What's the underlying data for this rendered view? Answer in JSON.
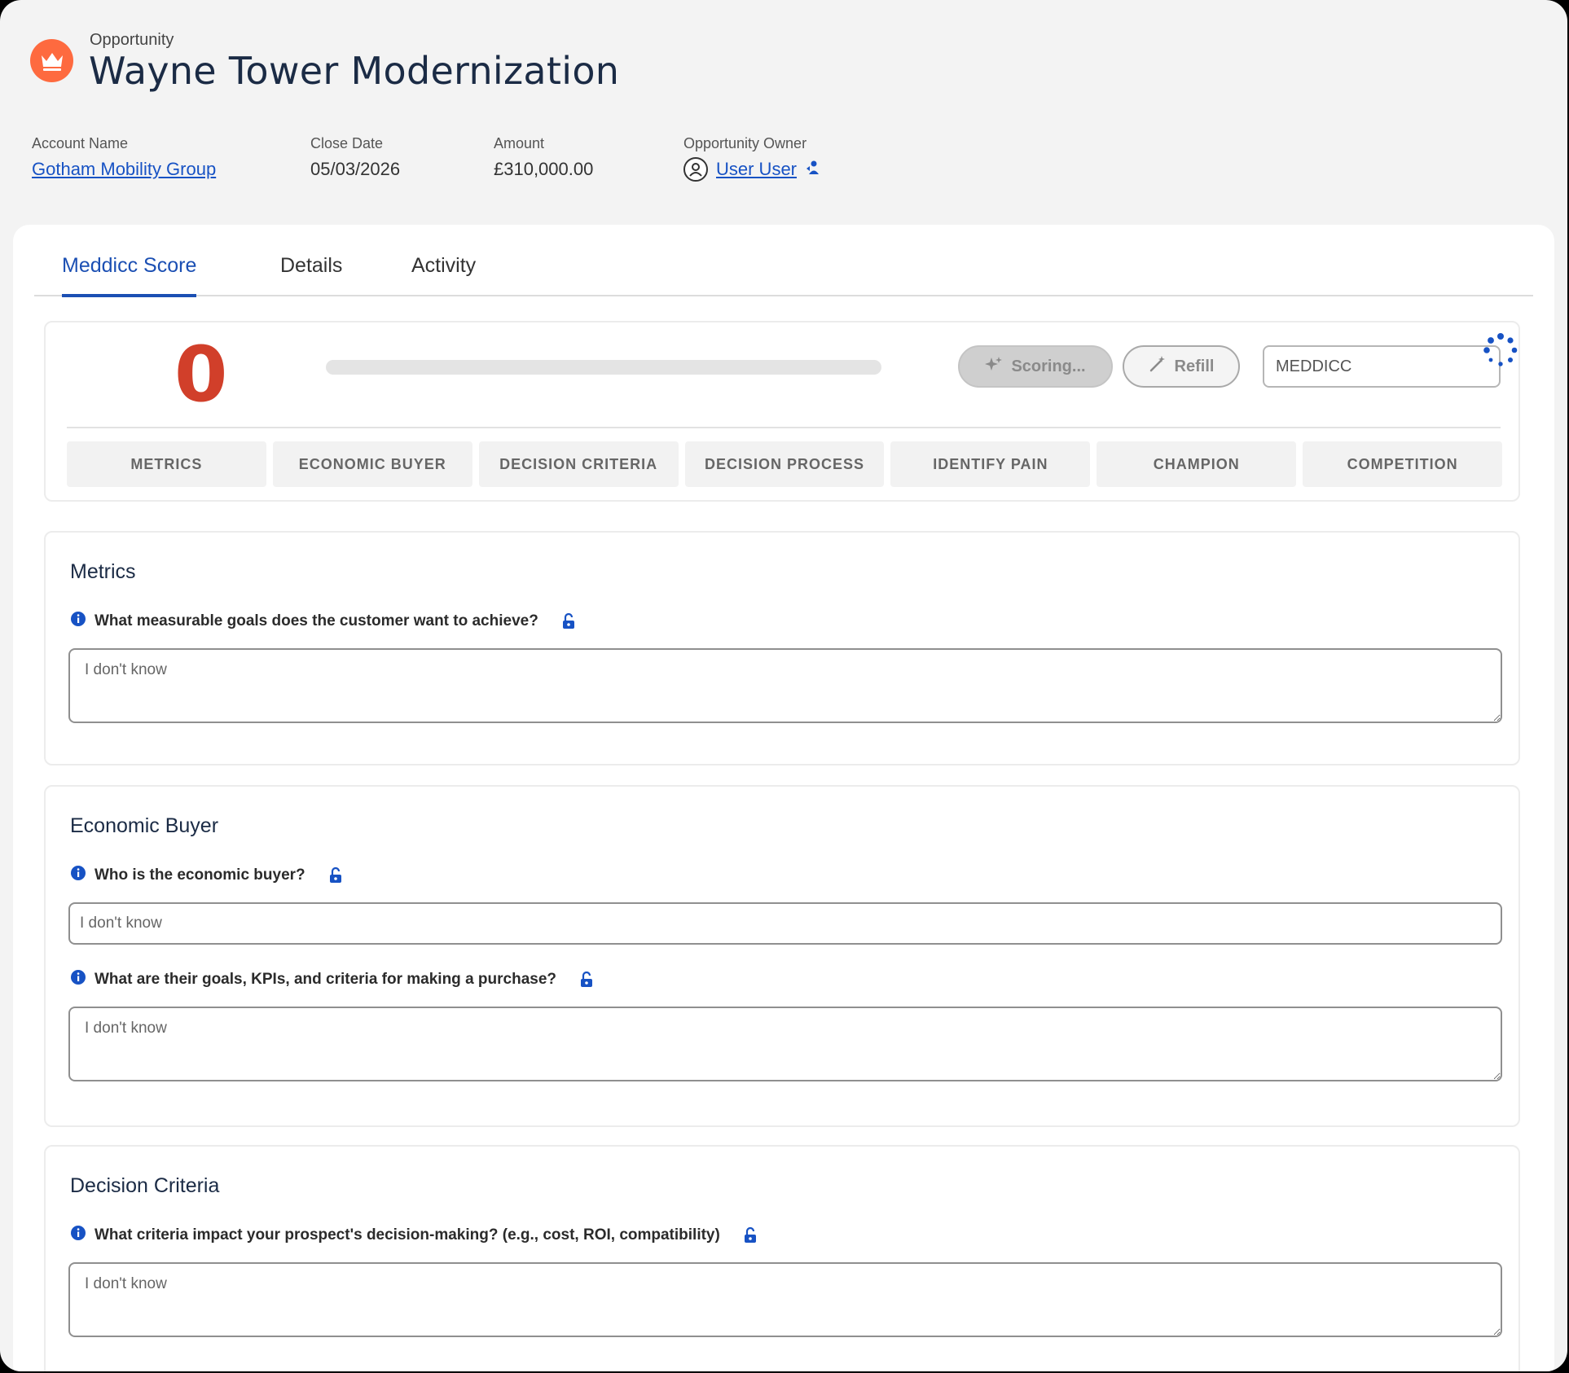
{
  "header": {
    "object_type": "Opportunity",
    "title": "Wayne Tower Modernization",
    "icon": "crown-icon",
    "accent_color": "#fe6a3f",
    "fields": {
      "account_name": {
        "label": "Account Name",
        "value": "Gotham Mobility Group"
      },
      "close_date": {
        "label": "Close Date",
        "value": "05/03/2026"
      },
      "amount": {
        "label": "Amount",
        "value": "£310,000.00"
      },
      "owner": {
        "label": "Opportunity Owner",
        "value": "User User"
      }
    }
  },
  "tabs": [
    {
      "label": "Meddicc Score",
      "active": true
    },
    {
      "label": "Details",
      "active": false
    },
    {
      "label": "Activity",
      "active": false
    }
  ],
  "score": {
    "value": "0",
    "progress": 0,
    "scoring_label": "Scoring...",
    "refill_label": "Refill",
    "framework": "MEDDICC",
    "score_color": "#d13f2a"
  },
  "categories": [
    "METRICS",
    "ECONOMIC BUYER",
    "DECISION CRITERIA",
    "DECISION PROCESS",
    "IDENTIFY PAIN",
    "CHAMPION",
    "COMPETITION"
  ],
  "sections": {
    "metrics": {
      "title": "Metrics",
      "questions": [
        {
          "text": "What measurable goals does the customer want to achieve?",
          "placeholder": "I don't know"
        }
      ]
    },
    "economic_buyer": {
      "title": "Economic Buyer",
      "questions": [
        {
          "text": "Who is the economic buyer?",
          "placeholder": "I don't know"
        },
        {
          "text": "What are their goals, KPIs, and criteria for making a purchase?",
          "placeholder": "I don't know"
        }
      ]
    },
    "decision_criteria": {
      "title": "Decision Criteria",
      "questions": [
        {
          "text": "What criteria impact your prospect's decision-making? (e.g., cost, ROI, compatibility)",
          "placeholder": "I don't know"
        }
      ]
    }
  }
}
